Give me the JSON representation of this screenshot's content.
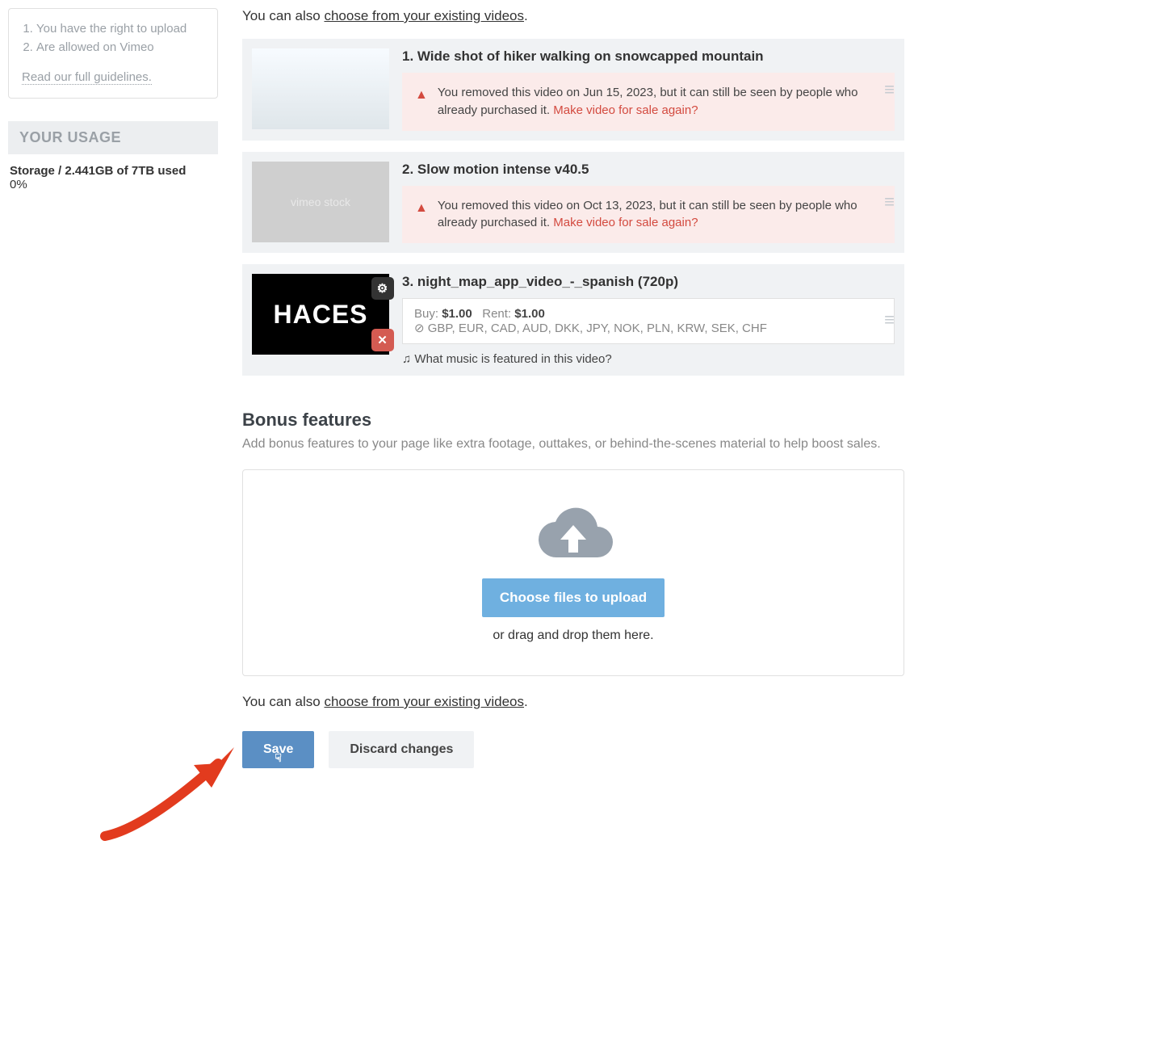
{
  "sidebar": {
    "guidelines": {
      "items": [
        "You have the right to upload",
        "Are allowed on Vimeo"
      ],
      "link": "Read our full guidelines."
    },
    "usage": {
      "header": "YOUR USAGE",
      "storage_line": "Storage / 2.441GB of 7TB used",
      "percent": "0%"
    }
  },
  "main": {
    "existing_prefix": "You can also ",
    "existing_link": "choose from your existing videos",
    "existing_suffix": ".",
    "videos": [
      {
        "title": "1. Wide shot of hiker walking on snowcapped mountain",
        "warn_text": "You removed this video on Jun 15, 2023, but it can still be seen by people who already purchased it. ",
        "resale_link": "Make video for sale again?",
        "thumb_label": ""
      },
      {
        "title": "2. Slow motion intense v40.5",
        "warn_text": "You removed this video on Oct 13, 2023, but it can still be seen by people who already purchased it. ",
        "resale_link": "Make video for sale again?",
        "thumb_label": "vimeo stock"
      },
      {
        "title": "3. night_map_app_video_-_spanish (720p)",
        "buy_label": "Buy:",
        "buy_price": "$1.00",
        "rent_label": "Rent:",
        "rent_price": "$1.00",
        "currencies": "GBP, EUR, CAD, AUD, DKK, JPY, NOK, PLN, KRW, SEK, CHF",
        "music_q": "What music is featured in this video?",
        "thumb_label": "HACES"
      }
    ],
    "bonus": {
      "title": "Bonus features",
      "subtitle": "Add bonus features to your page like extra footage, outtakes, or behind-the-scenes material to help boost sales.",
      "choose_btn": "Choose files to upload",
      "drag_text": "or drag and drop them here."
    },
    "buttons": {
      "save": "Save",
      "discard": "Discard changes"
    }
  }
}
